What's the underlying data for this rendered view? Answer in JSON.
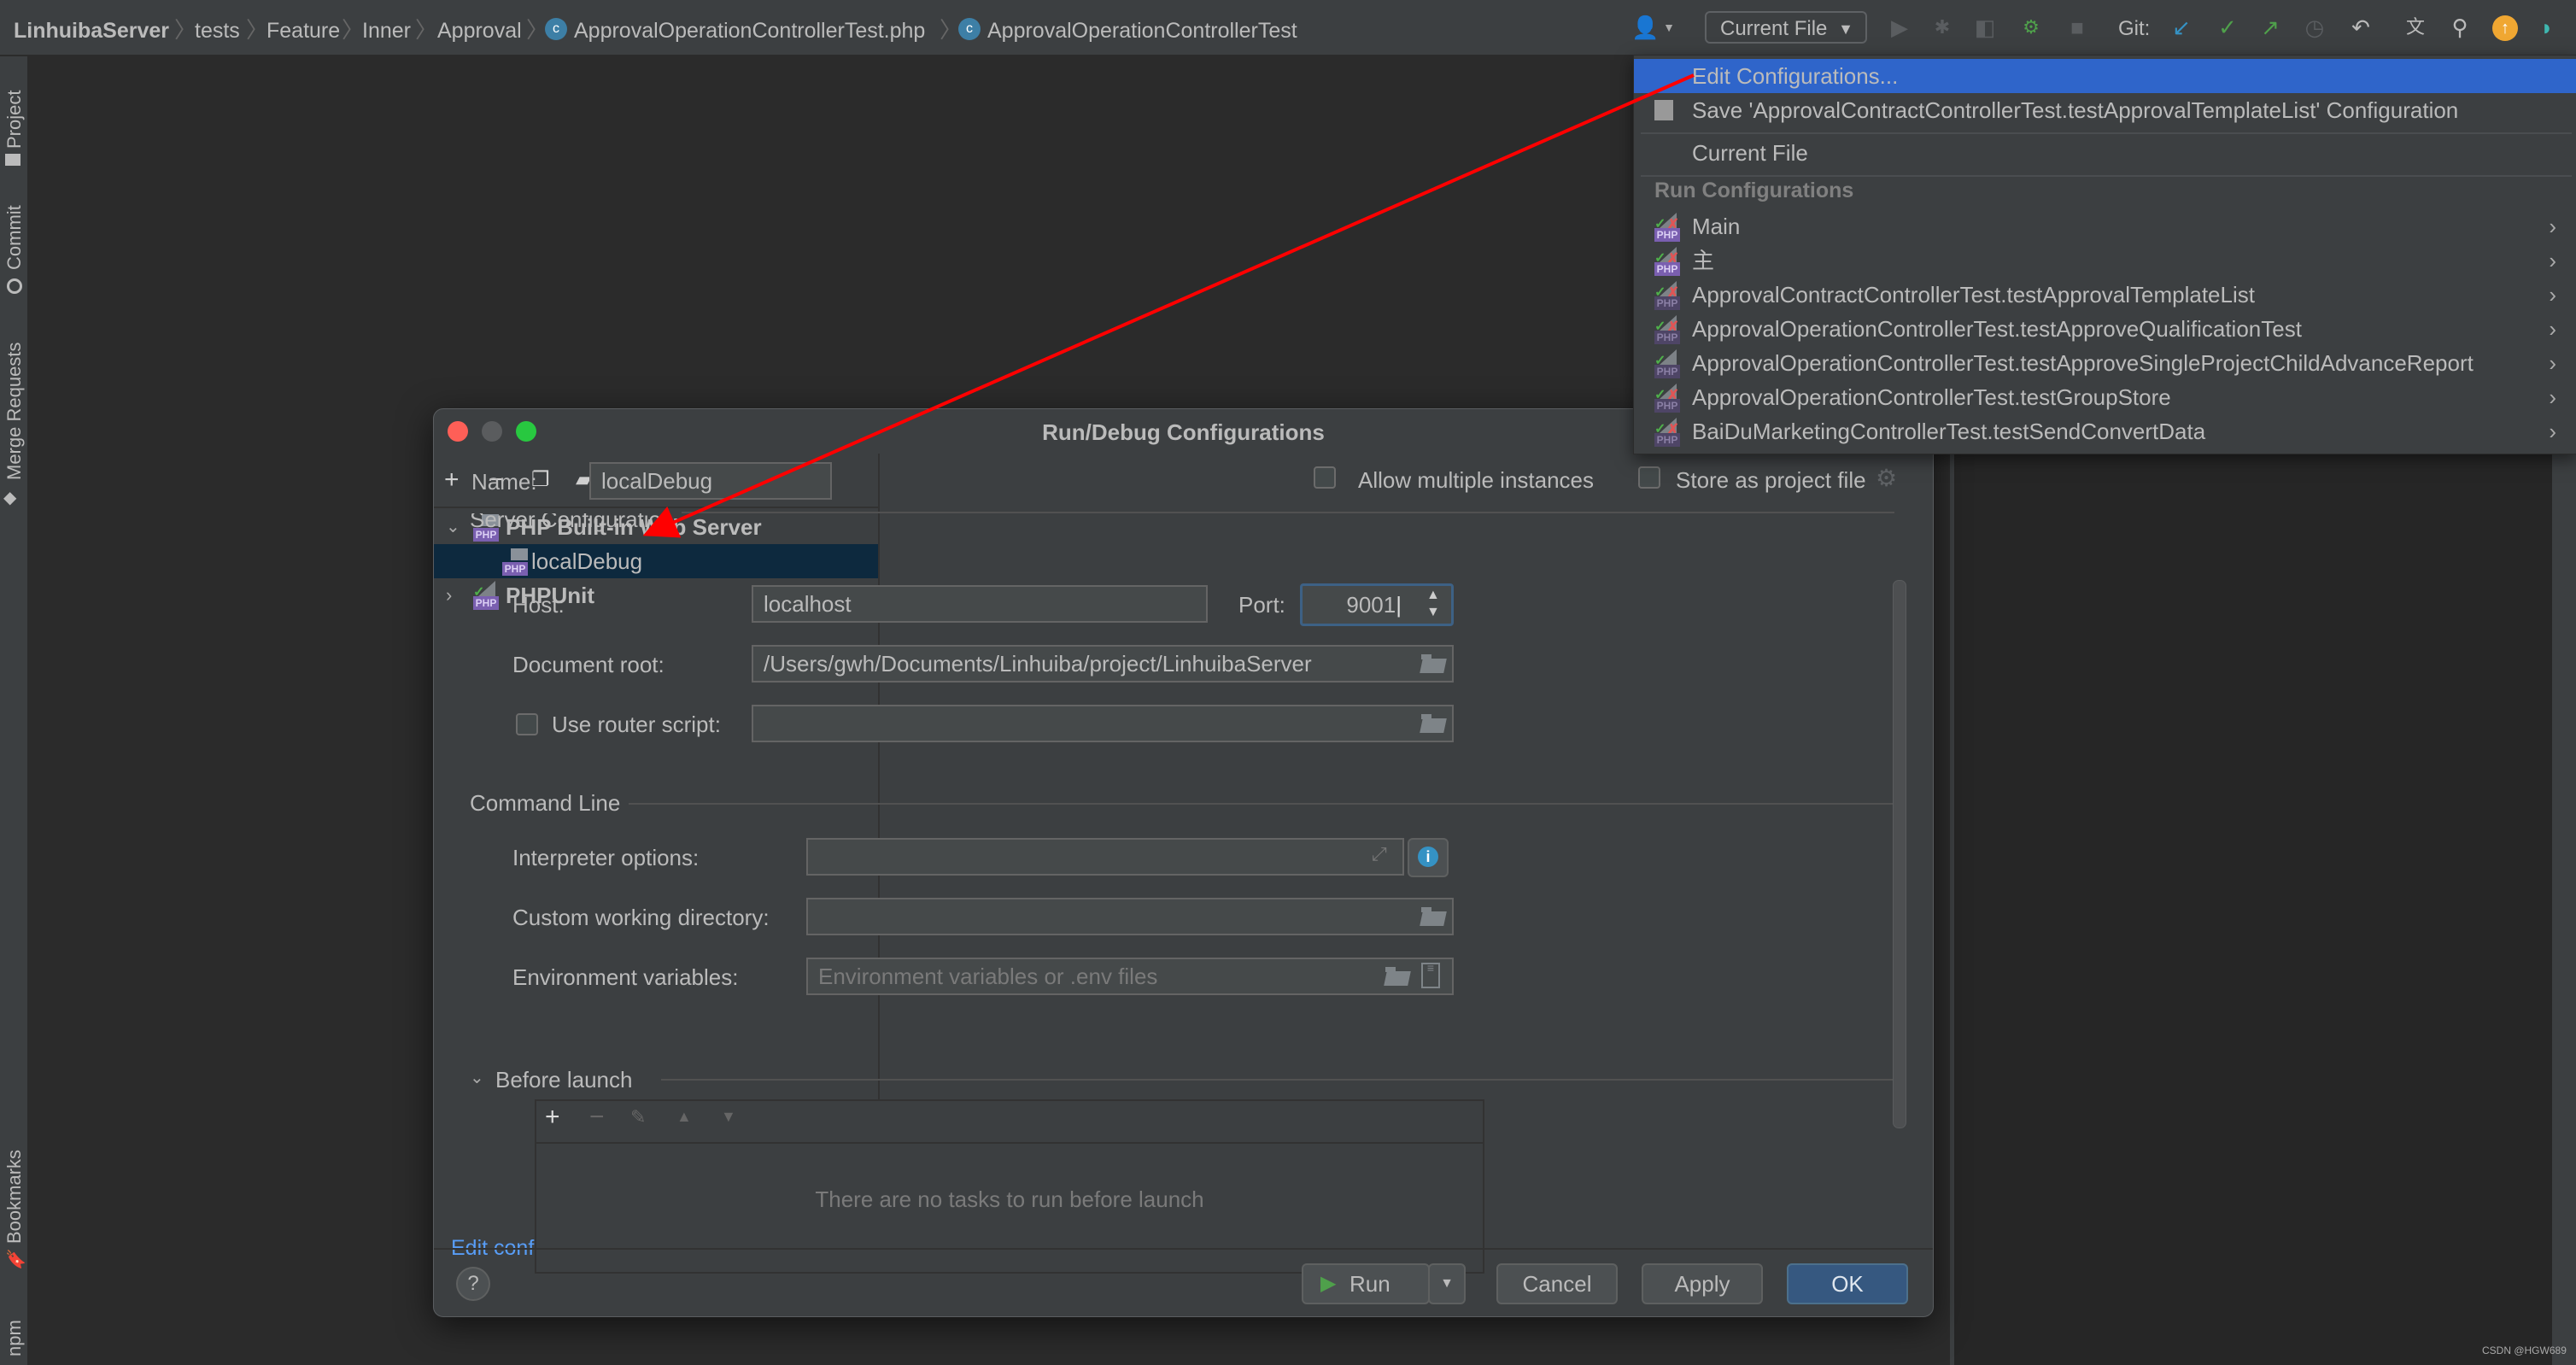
{
  "breadcrumb": {
    "items": [
      "LinhuibaServer",
      "tests",
      "Feature",
      "Inner",
      "Approval",
      "ApprovalOperationControllerTest.php",
      "ApprovalOperationControllerTest"
    ]
  },
  "toolbar": {
    "run_config": "Current File",
    "git_label": "Git:",
    "icons": [
      "user-icon",
      "run-icon",
      "debug-icon",
      "coverage-icon",
      "profile-icon",
      "stop-icon",
      "git-update-icon",
      "git-commit-icon",
      "git-push-icon",
      "history-icon",
      "rollback-icon",
      "translate-icon",
      "search-icon",
      "update-icon",
      "toolbox-icon"
    ]
  },
  "left_strip": {
    "top": [
      "Project",
      "Commit",
      "Merge Requests"
    ],
    "bottom": [
      "Bookmarks",
      "npm"
    ]
  },
  "menu": {
    "edit": "Edit Configurations...",
    "save": "Save 'ApprovalContractControllerTest.testApprovalTemplateList' Configuration",
    "current": "Current File",
    "group": "Run Configurations",
    "items": [
      "Main",
      "主",
      "ApprovalContractControllerTest.testApprovalTemplateList",
      "ApprovalOperationControllerTest.testApproveQualificationTest",
      "ApprovalOperationControllerTest.testApproveSingleProjectChildAdvanceReport",
      "ApprovalOperationControllerTest.testGroupStore",
      "BaiDuMarketingControllerTest.testSendConvertData"
    ]
  },
  "dialog": {
    "title": "Run/Debug Configurations",
    "tree": {
      "group1": "PHP Built-in Web Server",
      "child1": "localDebug",
      "group2": "PHPUnit"
    },
    "edit_templates": "Edit configuration templates...",
    "name_label": "Name:",
    "name_value": "localDebug",
    "allow_multiple": "Allow multiple instances",
    "store_project": "Store as project file",
    "server_section": "Server Configuration",
    "host_label": "Host:",
    "host_value": "localhost",
    "port_label": "Port:",
    "port_value": "9001",
    "docroot_label": "Document root:",
    "docroot_value": "/Users/gwh/Documents/Linhuiba/project/LinhuibaServer",
    "router_label": "Use router script:",
    "router_value": "",
    "cmd_section": "Command Line",
    "interp_label": "Interpreter options:",
    "interp_value": "",
    "cwd_label": "Custom working directory:",
    "cwd_value": "",
    "env_label": "Environment variables:",
    "env_placeholder": "Environment variables or .env files",
    "before_section": "Before launch",
    "no_tasks": "There are no tasks to run before launch",
    "buttons": {
      "help": "?",
      "run": "Run",
      "cancel": "Cancel",
      "apply": "Apply",
      "ok": "OK"
    }
  },
  "watermark": "CSDN @HGW689",
  "colors": {
    "accent": "#2f65ca",
    "link": "#589df6",
    "annotation_arrow": "#ff0000"
  }
}
